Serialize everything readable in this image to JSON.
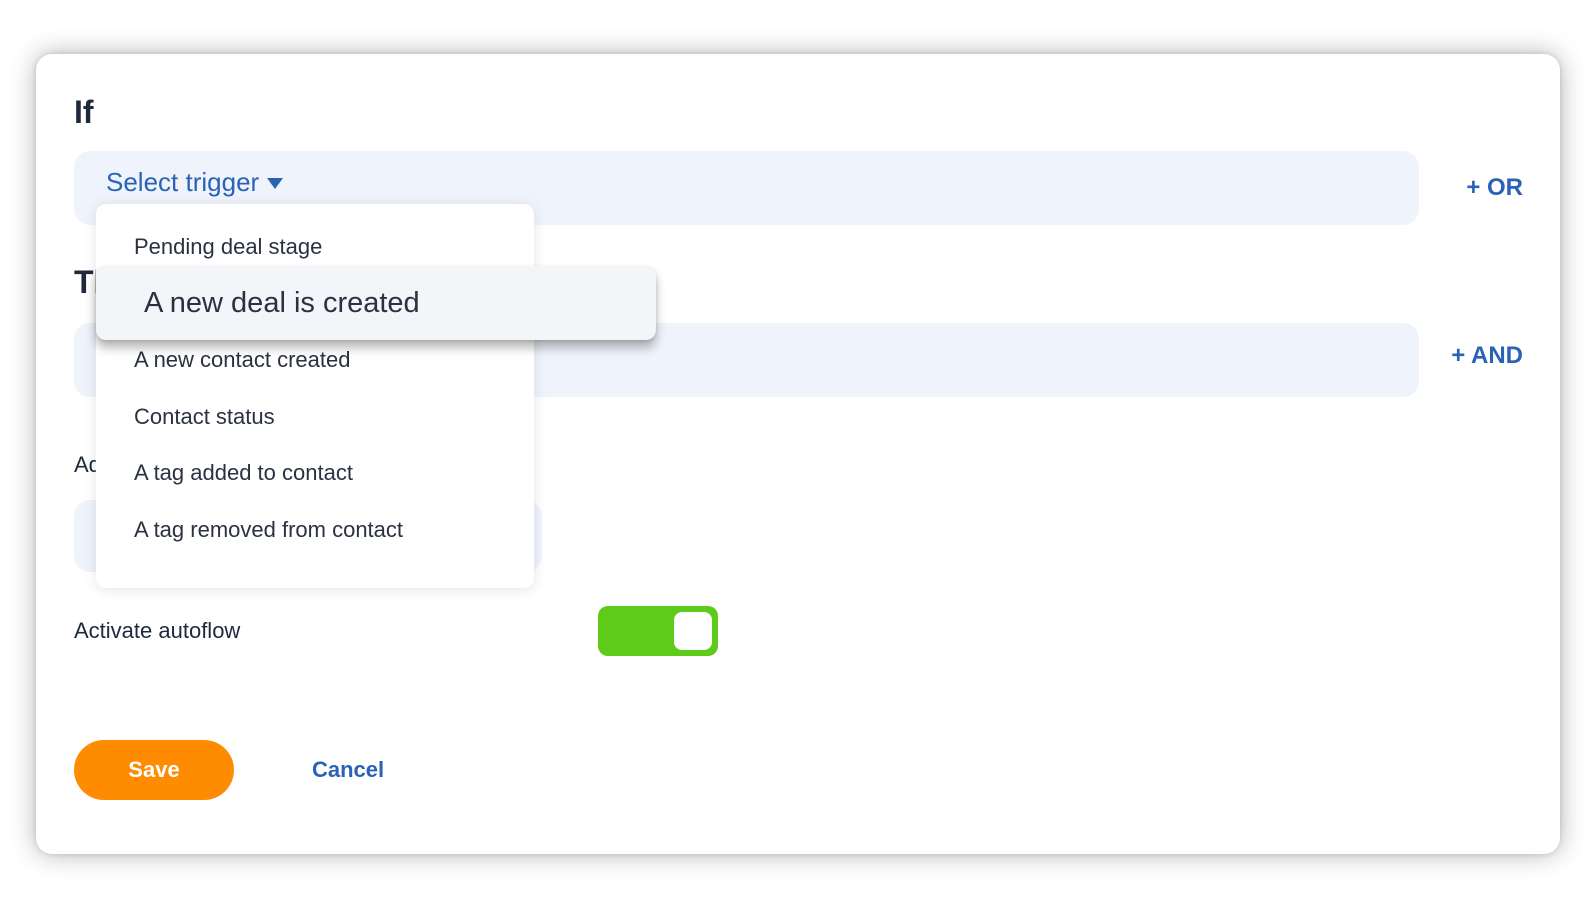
{
  "if_section": {
    "title": "If",
    "trigger_placeholder": "Select trigger",
    "or_button": "+ OR"
  },
  "then_section": {
    "title": "Then",
    "and_button": "+ AND"
  },
  "additional": {
    "label": "Add"
  },
  "activate": {
    "label": "Activate autoflow",
    "enabled": true,
    "toggle_color": "#5ecb1a"
  },
  "footer": {
    "save_label": "Save",
    "cancel_label": "Cancel",
    "save_color": "#ff8c00"
  },
  "dropdown": {
    "items": [
      "Pending deal stage",
      "A new deal is created",
      "A new contact created",
      "Contact status",
      "A tag added to contact",
      "A tag removed from contact"
    ],
    "highlighted_index": 1
  },
  "colors": {
    "accent": "#2b63b4",
    "field_bg": "#eef3fc",
    "text": "#1e2a3c"
  },
  "icons": {
    "trigger_caret": "caret-down-icon",
    "toggle_knob": "toggle-knob"
  }
}
